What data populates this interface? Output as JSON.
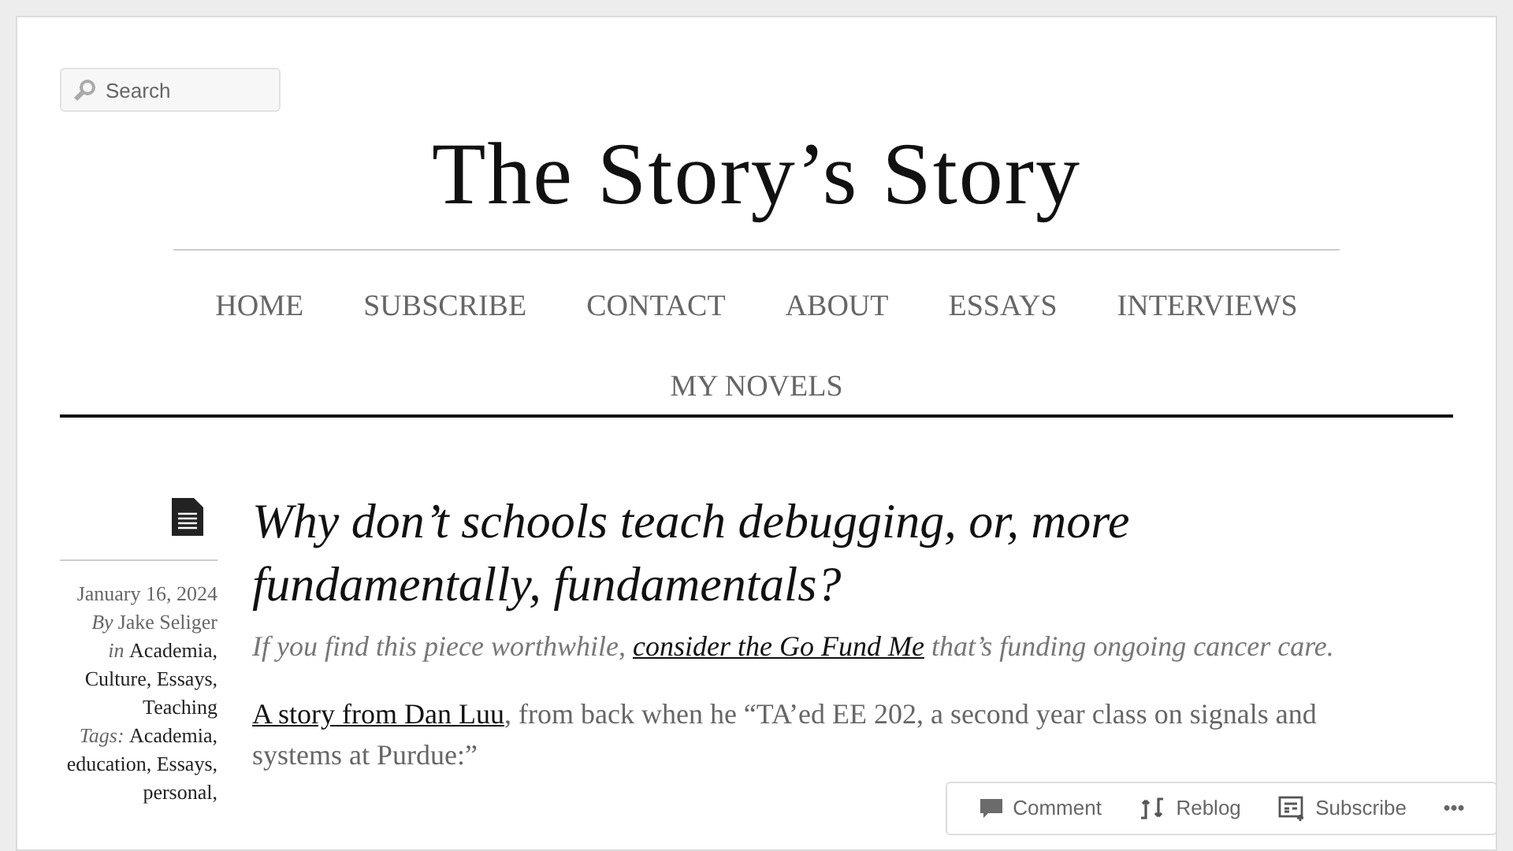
{
  "search": {
    "placeholder": "Search"
  },
  "site_title": "The Story’s Story",
  "nav": [
    {
      "label": "HOME"
    },
    {
      "label": "SUBSCRIBE"
    },
    {
      "label": "CONTACT"
    },
    {
      "label": "ABOUT"
    },
    {
      "label": "ESSAYS"
    },
    {
      "label": "INTERVIEWS"
    },
    {
      "label": "MY NOVELS"
    }
  ],
  "post": {
    "date": "January 16, 2024",
    "by_label": "By",
    "author": "Jake Seliger",
    "in_label": "in",
    "categories": [
      "Academia,",
      "Culture,",
      "Essays,",
      "Teaching"
    ],
    "tags_label": "Tags:",
    "tags": [
      "Academia,",
      "education,",
      "Essays,",
      "personal,"
    ],
    "title": "Why don’t schools teach debugging, or, more fundamentally, fundamentals?",
    "intro": {
      "before": "If you find this piece worthwhile,",
      "link": "consider the Go Fund Me",
      "after": "that’s funding ongoing cancer care."
    },
    "paragraph": {
      "link": "A story from Dan Luu",
      "text": ", from back when he “TA’ed EE 202, a second year class on signals and systems at Purdue:”"
    }
  },
  "action_bar": [
    {
      "kind": "comment",
      "label": "Comment"
    },
    {
      "kind": "reblog",
      "label": "Reblog"
    },
    {
      "kind": "subscribe",
      "label": "Subscribe"
    },
    {
      "kind": "more",
      "label": "•••"
    }
  ]
}
